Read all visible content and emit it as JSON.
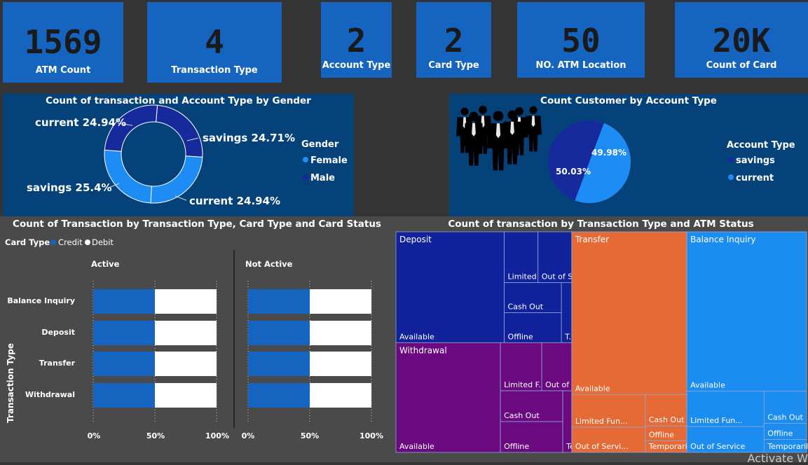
{
  "kpis": [
    {
      "value": "1569",
      "label": "ATM Count"
    },
    {
      "value": "4",
      "label": "Transaction Type"
    },
    {
      "value": "2",
      "label": "Account Type"
    },
    {
      "value": "2",
      "label": "Card Type"
    },
    {
      "value": "50",
      "label": "NO. ATM Location"
    },
    {
      "value": "20K",
      "label": "Count of Card"
    }
  ],
  "colors": {
    "accent": "#1565c0",
    "panel": "#06427a",
    "dark": "#162a9c",
    "light": "#1e8cf5"
  },
  "donut": {
    "title": "Count of transaction and Account Type by Gender",
    "legend_title": "Gender",
    "legend": [
      "Female",
      "Male"
    ],
    "labels": [
      "current 24.94%",
      "savings 24.71%",
      "current 24.94%",
      "savings 25.4%"
    ]
  },
  "pie": {
    "title": "Count Customer by Account Type",
    "legend_title": "Account Type",
    "legend": [
      "savings",
      "current"
    ],
    "labels": [
      "49.98%",
      "50.03%"
    ]
  },
  "bars": {
    "title": "Count of Transaction by Transaction Type, Card Type and Card Status",
    "legend_title": "Card Type",
    "legend": [
      "Credit",
      "Debit"
    ],
    "facets": [
      "Active",
      "Not Active"
    ],
    "yaxis_title": "Transaction Type",
    "ticks": [
      "0%",
      "50%",
      "100%"
    ]
  },
  "treemap": {
    "title": "Count of transaction by Transaction Type and ATM Status"
  },
  "watermark": "Activate W",
  "chart_data": [
    {
      "type": "pie",
      "donut": true,
      "title": "Count of transaction and Account Type by Gender",
      "legend": "Gender",
      "slices": [
        {
          "label": "savings",
          "gender": "Male",
          "percent": 24.71
        },
        {
          "label": "current",
          "gender": "Female",
          "percent": 24.94
        },
        {
          "label": "savings",
          "gender": "Female",
          "percent": 25.4
        },
        {
          "label": "current",
          "gender": "Male",
          "percent": 24.94
        }
      ]
    },
    {
      "type": "pie",
      "title": "Count Customer by Account Type",
      "legend": "Account Type",
      "slices": [
        {
          "label": "current",
          "percent": 49.98
        },
        {
          "label": "savings",
          "percent": 50.03
        }
      ]
    },
    {
      "type": "bar",
      "orientation": "horizontal",
      "stacked": "100%",
      "title": "Count of Transaction by Transaction Type, Card Type and Card Status",
      "ylabel": "Transaction Type",
      "legend_placement": "top-left",
      "categories": [
        "Balance Inquiry",
        "Deposit",
        "Transfer",
        "Withdrawal"
      ],
      "facets": [
        {
          "name": "Active",
          "series": [
            {
              "name": "Credit",
              "values": [
                50,
                50,
                50,
                50
              ]
            },
            {
              "name": "Debit",
              "values": [
                50,
                50,
                50,
                50
              ]
            }
          ]
        },
        {
          "name": "Not Active",
          "series": [
            {
              "name": "Credit",
              "values": [
                50,
                50,
                50,
                50
              ]
            },
            {
              "name": "Debit",
              "values": [
                50,
                50,
                50,
                50
              ]
            }
          ]
        }
      ],
      "xlim": [
        0,
        100
      ]
    },
    {
      "type": "treemap",
      "title": "Count of transaction by Transaction Type and ATM Status",
      "groups": [
        {
          "name": "Deposit",
          "color": "#11229a",
          "cells": [
            {
              "label": "Available",
              "value": 17.5
            },
            {
              "label": "Limited ...",
              "value": 2.5
            },
            {
              "label": "Out of S...",
              "value": 2.5
            },
            {
              "label": "Cash Out",
              "value": 2.5
            },
            {
              "label": "Offline",
              "value": 2.5
            },
            {
              "label": "T...",
              "value": 0.9
            }
          ]
        },
        {
          "name": "Withdrawal",
          "color": "#6b0a80",
          "cells": [
            {
              "label": "Available",
              "value": 16.7
            },
            {
              "label": "Limited F...",
              "value": 2.9
            },
            {
              "label": "Out of ...",
              "value": 2.1
            },
            {
              "label": "Cash Out",
              "value": 2.8
            },
            {
              "label": "Offline",
              "value": 2.8
            },
            {
              "label": "Te...",
              "value": 0.8
            }
          ]
        },
        {
          "name": "Transfer",
          "color": "#e56a35",
          "cells": [
            {
              "label": "Available",
              "value": 27.3
            },
            {
              "label": "Limited Fun...",
              "value": 3.5
            },
            {
              "label": "Out of Servi...",
              "value": 2.7
            },
            {
              "label": "Cash Out",
              "value": 1.9
            },
            {
              "label": "Offline",
              "value": 0.9
            },
            {
              "label": "Temporaril...",
              "value": 0.7
            }
          ]
        },
        {
          "name": "Balance Inquiry",
          "color": "#1b8cf0",
          "cells": [
            {
              "label": "Available",
              "value": 27.8
            },
            {
              "label": "Limited Fun...",
              "value": 4.0
            },
            {
              "label": "Out of Service",
              "value": 2.9
            },
            {
              "label": "Cash Out",
              "value": 2.0
            },
            {
              "label": "Offline",
              "value": 1.0
            },
            {
              "label": "Temporaril...",
              "value": 0.8
            }
          ]
        }
      ]
    }
  ]
}
